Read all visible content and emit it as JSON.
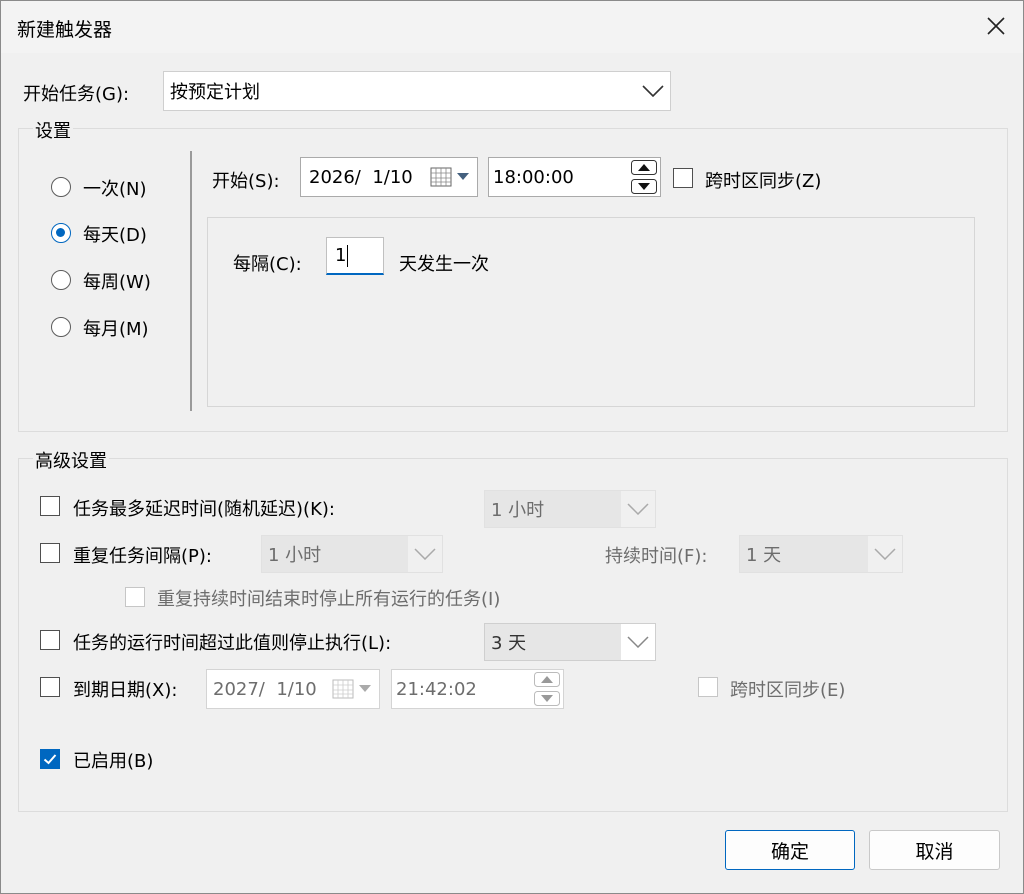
{
  "window": {
    "title": "新建触发器"
  },
  "begin_task": {
    "label": "开始任务(G):",
    "value": "按预定计划"
  },
  "settings": {
    "title": "设置",
    "radios": [
      {
        "label": "一次(N)",
        "selected": false
      },
      {
        "label": "每天(D)",
        "selected": true
      },
      {
        "label": "每周(W)",
        "selected": false
      },
      {
        "label": "每月(M)",
        "selected": false
      }
    ],
    "start_label": "开始(S):",
    "start_date": "2026/  1/10",
    "start_time": "18:00:00",
    "sync_tz": {
      "label": "跨时区同步(Z)",
      "checked": false
    },
    "recur_label": "每隔(C):",
    "recur_value": "1",
    "recur_suffix": "天发生一次"
  },
  "advanced": {
    "title": "高级设置",
    "delay": {
      "label": "任务最多延迟时间(随机延迟)(K):",
      "checked": false,
      "value": "1 小时"
    },
    "repeat": {
      "label": "重复任务间隔(P):",
      "checked": false,
      "value": "1 小时",
      "duration_label": "持续时间(F):",
      "duration_value": "1 天"
    },
    "stop_all": {
      "label": "重复持续时间结束时停止所有运行的任务(I)",
      "checked": false
    },
    "stop_exceed": {
      "label": "任务的运行时间超过此值则停止执行(L):",
      "checked": false,
      "value": "3 天"
    },
    "expire": {
      "label": "到期日期(X):",
      "checked": false,
      "date": "2027/  1/10",
      "time": "21:42:02",
      "sync_label": "跨时区同步(E)"
    },
    "enabled": {
      "label": "已启用(B)",
      "checked": true
    }
  },
  "buttons": {
    "ok": "确定",
    "cancel": "取消"
  },
  "colors": {
    "accent": "#0067c0",
    "background": "#f0f0f0"
  }
}
